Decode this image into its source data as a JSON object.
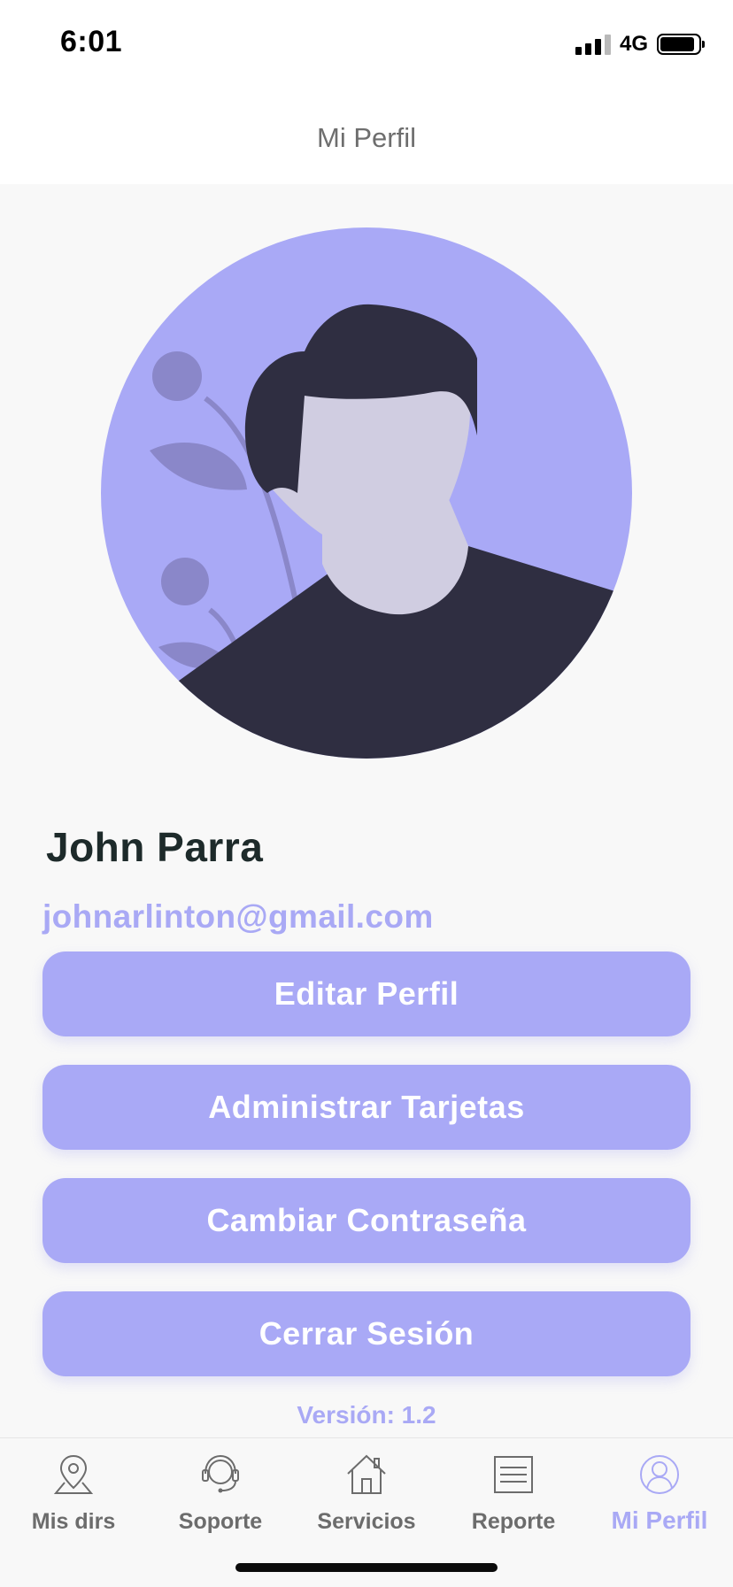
{
  "status_bar": {
    "time": "6:01",
    "network": "4G"
  },
  "header": {
    "title": "Mi Perfil"
  },
  "profile": {
    "name": "John Parra",
    "email": "johnarlinton@gmail.com"
  },
  "actions": {
    "edit_profile": "Editar Perfil",
    "manage_cards": "Administrar Tarjetas",
    "change_password": "Cambiar Contraseña",
    "logout": "Cerrar Sesión"
  },
  "version": "Versión: 1.2",
  "tabs": [
    {
      "label": "Mis dirs",
      "icon": "map-pin-icon",
      "active": false
    },
    {
      "label": "Soporte",
      "icon": "headset-icon",
      "active": false
    },
    {
      "label": "Servicios",
      "icon": "house-icon",
      "active": false
    },
    {
      "label": "Reporte",
      "icon": "document-icon",
      "active": false
    },
    {
      "label": "Mi Perfil",
      "icon": "user-icon",
      "active": true
    }
  ],
  "colors": {
    "accent": "#a9a9f6",
    "avatar_bg": "#a9a9f6",
    "hair_shirt": "#2f2e41",
    "skin": "#d0cde1",
    "plant": "#8a87c9",
    "text_dark": "#1d2a2a",
    "tab_inactive": "#6c6c6c"
  }
}
